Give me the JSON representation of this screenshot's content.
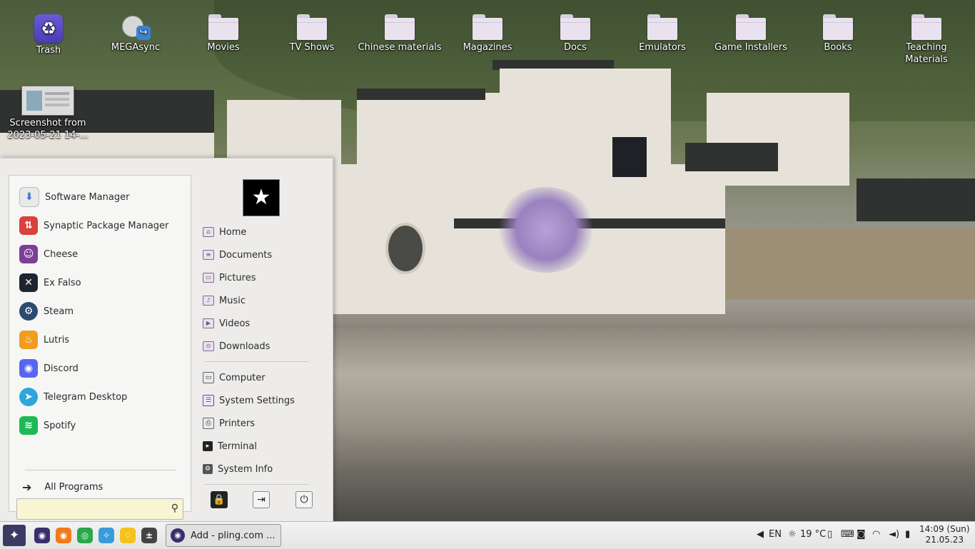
{
  "desktop": {
    "icons": [
      {
        "label": "Trash",
        "icon": "trash-icon"
      },
      {
        "label": "MEGAsync",
        "icon": "megasync-icon"
      },
      {
        "label": "Movies",
        "icon": "folder-icon"
      },
      {
        "label": "TV Shows",
        "icon": "folder-icon"
      },
      {
        "label": "Chinese materials",
        "icon": "folder-icon"
      },
      {
        "label": "Magazines",
        "icon": "folder-icon"
      },
      {
        "label": "Docs",
        "icon": "folder-icon"
      },
      {
        "label": "Emulators",
        "icon": "folder-icon"
      },
      {
        "label": "Game Installers",
        "icon": "folder-icon"
      },
      {
        "label": "Books",
        "icon": "folder-icon"
      },
      {
        "label": "Teaching Materials",
        "icon": "folder-icon"
      },
      {
        "label": "Screenshot from 2023-05-21 14-...",
        "icon": "image-file-icon"
      }
    ]
  },
  "menu": {
    "apps": [
      {
        "label": "Software Manager",
        "icon": "software-manager-icon",
        "color": "#e8e8e8"
      },
      {
        "label": "Synaptic Package Manager",
        "icon": "synaptic-icon",
        "color": "#d9413a"
      },
      {
        "label": "Cheese",
        "icon": "cheese-icon",
        "color": "#7b3f96"
      },
      {
        "label": "Ex Falso",
        "icon": "ex-falso-icon",
        "color": "#1f2430"
      },
      {
        "label": "Steam",
        "icon": "steam-icon",
        "color": "#2a4b6e"
      },
      {
        "label": "Lutris",
        "icon": "lutris-icon",
        "color": "#f29c1f"
      },
      {
        "label": "Discord",
        "icon": "discord-icon",
        "color": "#5865f2"
      },
      {
        "label": "Telegram Desktop",
        "icon": "telegram-icon",
        "color": "#2ea5dc"
      },
      {
        "label": "Spotify",
        "icon": "spotify-icon",
        "color": "#1db954"
      }
    ],
    "all_programs": "All Programs",
    "search": {
      "placeholder": "",
      "value": ""
    },
    "places": [
      {
        "label": "Home",
        "icon": "home-folder-icon"
      },
      {
        "label": "Documents",
        "icon": "documents-folder-icon"
      },
      {
        "label": "Pictures",
        "icon": "pictures-folder-icon"
      },
      {
        "label": "Music",
        "icon": "music-folder-icon"
      },
      {
        "label": "Videos",
        "icon": "videos-folder-icon"
      },
      {
        "label": "Downloads",
        "icon": "downloads-folder-icon"
      }
    ],
    "system": [
      {
        "label": "Computer",
        "icon": "computer-icon"
      },
      {
        "label": "System Settings",
        "icon": "system-settings-icon"
      },
      {
        "label": "Printers",
        "icon": "printer-icon"
      },
      {
        "label": "Terminal",
        "icon": "terminal-icon"
      },
      {
        "label": "System Info",
        "icon": "system-info-icon"
      }
    ]
  },
  "panel": {
    "task_title": "Add - pling.com ...",
    "keyboard_layout": "EN",
    "weather": "19 °C",
    "clock_time": "14:09 (Sun)",
    "clock_date": "21.05.23"
  }
}
